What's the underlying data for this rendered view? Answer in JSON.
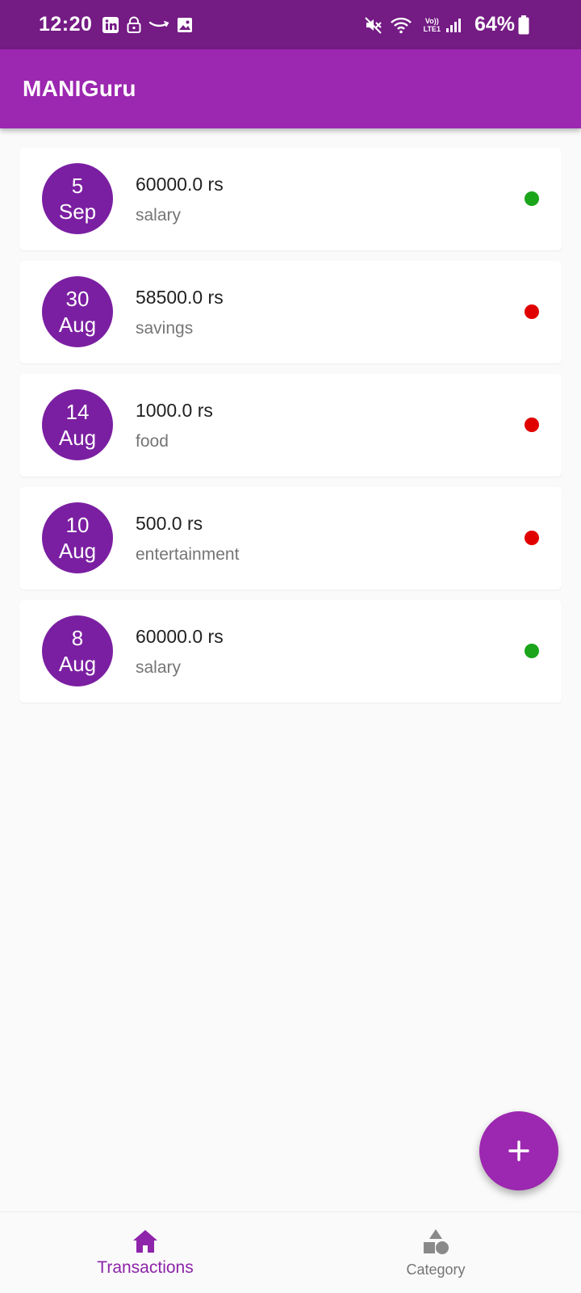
{
  "status_bar": {
    "time": "12:20",
    "icons": [
      "linkedin-icon",
      "lock-icon",
      "amazon-icon",
      "image-icon"
    ],
    "lte_top": "Vo))",
    "lte_bottom": "LTE1",
    "battery": "64%",
    "right_icons": [
      "mute-icon",
      "wifi-icon",
      "signal-icon",
      "battery-icon"
    ]
  },
  "app_bar": {
    "title": "MANIGuru"
  },
  "colors": {
    "primary": "#9c27b0",
    "status_bar": "#741b84",
    "date_circle": "#7b1fa2",
    "income": "#1aa51a",
    "expense": "#e00000"
  },
  "transactions": [
    {
      "day": "5",
      "month": "Sep",
      "amount": "60000.0 rs",
      "category": "salary",
      "type": "income",
      "dot_color": "#1aa51a"
    },
    {
      "day": "30",
      "month": "Aug",
      "amount": "58500.0 rs",
      "category": "savings",
      "type": "expense",
      "dot_color": "#e00000"
    },
    {
      "day": "14",
      "month": "Aug",
      "amount": "1000.0 rs",
      "category": "food",
      "type": "expense",
      "dot_color": "#e00000"
    },
    {
      "day": "10",
      "month": "Aug",
      "amount": "500.0 rs",
      "category": "entertainment",
      "type": "expense",
      "dot_color": "#e00000"
    },
    {
      "day": "8",
      "month": "Aug",
      "amount": "60000.0 rs",
      "category": "salary",
      "type": "income",
      "dot_color": "#1aa51a"
    }
  ],
  "fab": {
    "icon": "plus-icon"
  },
  "bottom_nav": [
    {
      "label": "Transactions",
      "icon": "home-icon",
      "active": true
    },
    {
      "label": "Category",
      "icon": "shapes-icon",
      "active": false
    }
  ]
}
